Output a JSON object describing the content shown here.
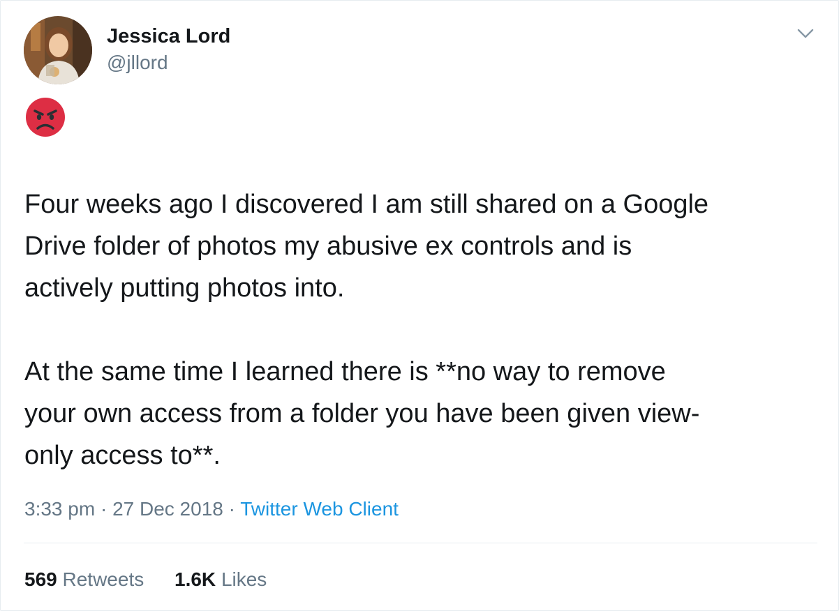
{
  "user": {
    "name": "Jessica Lord",
    "handle": "@jllord",
    "avatar_icon": "profile-photo"
  },
  "tweet": {
    "emoji_icon": "angry-face-emoji",
    "text": "Four weeks ago I discovered I am still shared on a Google\nDrive folder of photos my abusive ex controls and is\nactively putting photos into.\n\nAt the same time I learned there is **no way to remove\nyour own access from a folder you have been given view-\nonly access to**.",
    "time": "3:33 pm",
    "date": "27 Dec 2018",
    "separator": "·",
    "client": "Twitter Web Client"
  },
  "stats": {
    "retweets_count": "569",
    "retweets_label": "Retweets",
    "likes_count": "1.6K",
    "likes_label": "Likes"
  },
  "colors": {
    "text": "#14171a",
    "secondary": "#657786",
    "link": "#1b95e0",
    "divider": "#e6ecf0",
    "emoji_red": "#dd2e44"
  }
}
